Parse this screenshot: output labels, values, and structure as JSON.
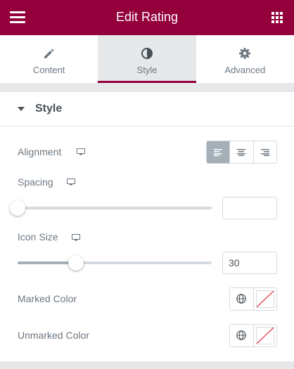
{
  "header": {
    "title": "Edit Rating",
    "menu_icon": "hamburger-icon",
    "apps_icon": "grid-icon",
    "bg_color": "#93003c"
  },
  "tabs": [
    {
      "label": "Content",
      "icon": "pencil-icon",
      "active": false
    },
    {
      "label": "Style",
      "icon": "half-circle-icon",
      "active": true
    },
    {
      "label": "Advanced",
      "icon": "gear-icon",
      "active": false
    }
  ],
  "section": {
    "title": "Style",
    "expanded": true
  },
  "controls": {
    "alignment": {
      "label": "Alignment",
      "device_icon": "desktop-icon",
      "options": [
        "left",
        "center",
        "right"
      ],
      "selected": "left"
    },
    "spacing": {
      "label": "Spacing",
      "device_icon": "desktop-icon",
      "value": "",
      "slider_percent": 0
    },
    "icon_size": {
      "label": "Icon Size",
      "device_icon": "desktop-icon",
      "value": "30",
      "slider_percent": 30
    },
    "marked_color": {
      "label": "Marked Color",
      "global_icon": "globe-icon",
      "swatch": "none"
    },
    "unmarked_color": {
      "label": "Unmarked Color",
      "global_icon": "globe-icon",
      "swatch": "none"
    }
  }
}
